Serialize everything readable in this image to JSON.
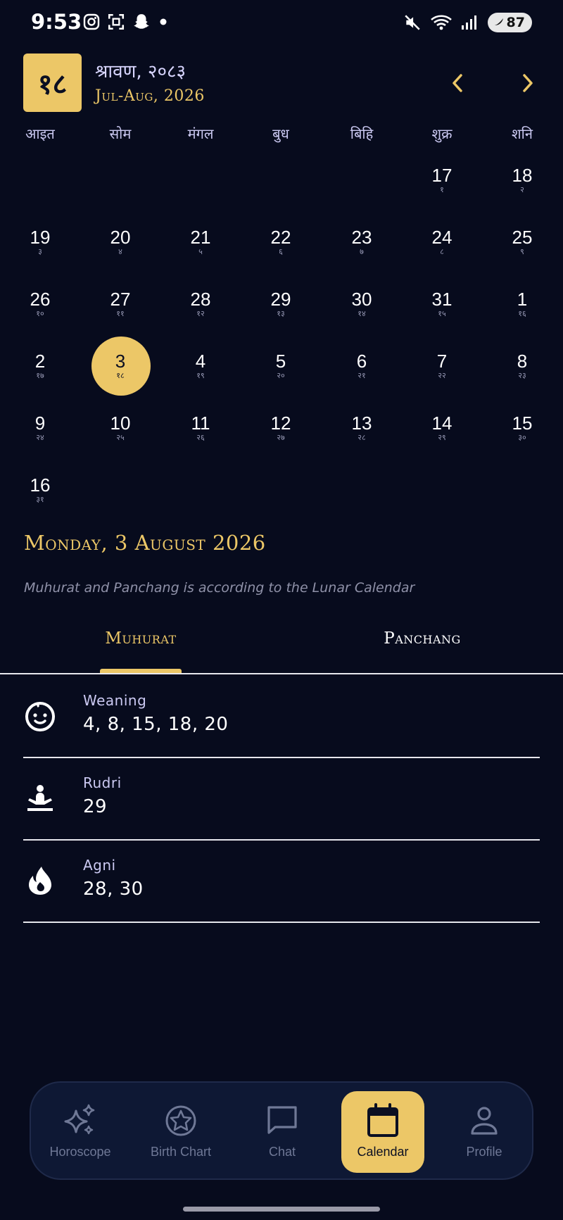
{
  "status_bar": {
    "time": "9:53",
    "battery": "87",
    "icons": [
      "instagram-icon",
      "screenshot-icon",
      "snapchat-icon",
      "dot-icon",
      "mute-icon",
      "wifi-icon",
      "signal-icon",
      "battery-icon"
    ]
  },
  "header": {
    "today_badge": "१८",
    "month_nepali": "श्रावण, २०८३",
    "month_english": "Jul-Aug, 2026",
    "prev_icon": "chevron-left-icon",
    "next_icon": "chevron-right-icon"
  },
  "weekdays": [
    "आइत",
    "सोम",
    "मंगल",
    "बुध",
    "बिहि",
    "शुक्र",
    "शनि"
  ],
  "calendar_days": [
    {
      "g": "17",
      "n": "१"
    },
    {
      "g": "18",
      "n": "२"
    },
    {
      "g": "19",
      "n": "३"
    },
    {
      "g": "20",
      "n": "४"
    },
    {
      "g": "21",
      "n": "५"
    },
    {
      "g": "22",
      "n": "६"
    },
    {
      "g": "23",
      "n": "७"
    },
    {
      "g": "24",
      "n": "८"
    },
    {
      "g": "25",
      "n": "९"
    },
    {
      "g": "26",
      "n": "१०"
    },
    {
      "g": "27",
      "n": "११"
    },
    {
      "g": "28",
      "n": "१२"
    },
    {
      "g": "29",
      "n": "१३"
    },
    {
      "g": "30",
      "n": "१४"
    },
    {
      "g": "31",
      "n": "१५"
    },
    {
      "g": "1",
      "n": "१६"
    },
    {
      "g": "2",
      "n": "१७"
    },
    {
      "g": "3",
      "n": "१८"
    },
    {
      "g": "4",
      "n": "१९"
    },
    {
      "g": "5",
      "n": "२०"
    },
    {
      "g": "6",
      "n": "२१"
    },
    {
      "g": "7",
      "n": "२२"
    },
    {
      "g": "8",
      "n": "२३"
    },
    {
      "g": "9",
      "n": "२४"
    },
    {
      "g": "10",
      "n": "२५"
    },
    {
      "g": "11",
      "n": "२६"
    },
    {
      "g": "12",
      "n": "२७"
    },
    {
      "g": "13",
      "n": "२८"
    },
    {
      "g": "14",
      "n": "२९"
    },
    {
      "g": "15",
      "n": "३०"
    },
    {
      "g": "16",
      "n": "३१"
    }
  ],
  "selected_day": "3",
  "selected_date_label": "Monday, 3 August 2026",
  "note": "Muhurat and Panchang is according to the Lunar Calendar",
  "tabs": [
    {
      "label": "Muhurat",
      "active": true
    },
    {
      "label": "Panchang",
      "active": false
    }
  ],
  "muhurat": [
    {
      "label": "Weaning",
      "value": "4, 8, 15, 18, 20",
      "icon": "baby-face-icon"
    },
    {
      "label": "Rudri",
      "value": "29",
      "icon": "meditation-icon"
    },
    {
      "label": "Agni",
      "value": "28, 30",
      "icon": "fire-icon"
    }
  ],
  "bottom_nav": [
    {
      "label": "Horoscope",
      "icon": "sparkles-icon",
      "active": false
    },
    {
      "label": "Birth Chart",
      "icon": "star-circle-icon",
      "active": false
    },
    {
      "label": "Chat",
      "icon": "chat-bubble-icon",
      "active": false
    },
    {
      "label": "Calendar",
      "icon": "calendar-icon",
      "active": true
    },
    {
      "label": "Profile",
      "icon": "person-icon",
      "active": false
    }
  ],
  "colors": {
    "background": "#070b1d",
    "accent": "#ecc767",
    "muted_text": "#cbc9f2",
    "nav_background": "#0e1834"
  }
}
